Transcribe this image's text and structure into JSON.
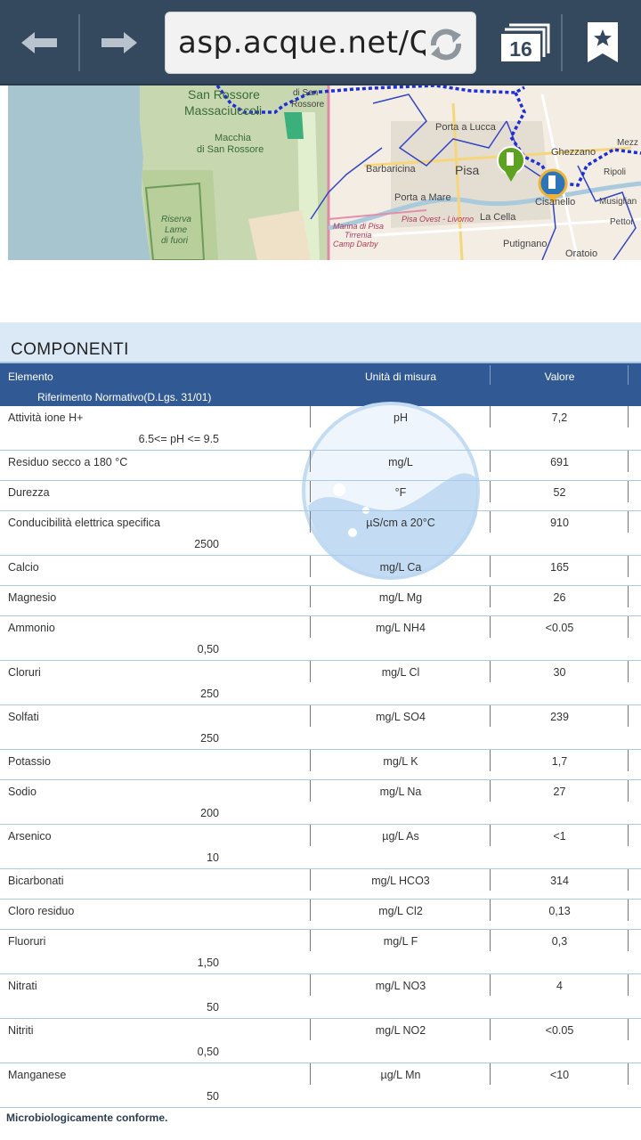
{
  "browser": {
    "url": "asp.acque.net/Q",
    "tab_count": "16"
  },
  "map": {
    "labels": [
      "San Rossore",
      "Massaciuccoli",
      "di San",
      "Rossore",
      "Macchia",
      "di San Rossore",
      "Riserva",
      "Lame",
      "di fuori",
      "Porta a Lucca",
      "Barbaricina",
      "Pisa",
      "Ghezzano",
      "Mezz",
      "Ripoli",
      "Porta a Mare",
      "Musiglian",
      "Cisanello",
      "Pisa Ovest - Livorno",
      "La Cella",
      "Marina di Pisa",
      "Tirrenia",
      "Camp Darby",
      "Putignano",
      "Pettor",
      "Oratoio"
    ]
  },
  "section": {
    "title": "COMPONENTI"
  },
  "table": {
    "headers": {
      "element": "Elemento",
      "unit": "Unità di misura",
      "value": "Valore",
      "norm": "Riferimento Normativo(D.Lgs. 31/01)"
    },
    "rows": [
      {
        "element": "Attività ione H+",
        "unit": "pH",
        "value": "7,2",
        "norm": "6.5<= pH <= 9.5"
      },
      {
        "element": "Residuo secco a 180 °C",
        "unit": "mg/L",
        "value": "691",
        "norm": ""
      },
      {
        "element": "Durezza",
        "unit": "°F",
        "value": "52",
        "norm": ""
      },
      {
        "element": "Conducibilità elettrica specifica",
        "unit": "µS/cm a 20°C",
        "value": "910",
        "norm": "2500"
      },
      {
        "element": "Calcio",
        "unit": "mg/L Ca",
        "value": "165",
        "norm": ""
      },
      {
        "element": "Magnesio",
        "unit": "mg/L Mg",
        "value": "26",
        "norm": ""
      },
      {
        "element": "Ammonio",
        "unit": "mg/L NH4",
        "value": "<0.05",
        "norm": "0,50"
      },
      {
        "element": "Cloruri",
        "unit": "mg/L Cl",
        "value": "30",
        "norm": "250"
      },
      {
        "element": "Solfati",
        "unit": "mg/L SO4",
        "value": "239",
        "norm": "250"
      },
      {
        "element": "Potassio",
        "unit": "mg/L K",
        "value": "1,7",
        "norm": ""
      },
      {
        "element": "Sodio",
        "unit": "mg/L Na",
        "value": "27",
        "norm": "200"
      },
      {
        "element": "Arsenico",
        "unit": "µg/L As",
        "value": "<1",
        "norm": "10"
      },
      {
        "element": "Bicarbonati",
        "unit": "mg/L HCO3",
        "value": "314",
        "norm": ""
      },
      {
        "element": "Cloro residuo",
        "unit": "mg/L Cl2",
        "value": "0,13",
        "norm": ""
      },
      {
        "element": "Fluoruri",
        "unit": "mg/L F",
        "value": "0,3",
        "norm": "1,50"
      },
      {
        "element": "Nitrati",
        "unit": "mg/L NO3",
        "value": "4",
        "norm": "50"
      },
      {
        "element": "Nitriti",
        "unit": "mg/L NO2",
        "value": "<0.05",
        "norm": "0,50"
      },
      {
        "element": "Manganese",
        "unit": "µg/L Mn",
        "value": "<10",
        "norm": "50"
      }
    ]
  },
  "footer": {
    "note": "Microbiologicamente conforme."
  }
}
